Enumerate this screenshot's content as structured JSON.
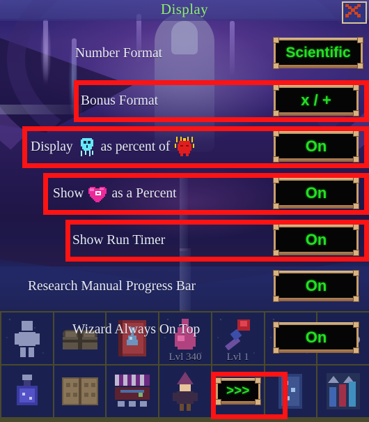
{
  "window": {
    "title": "Display",
    "close_icon": "close-x-icon"
  },
  "colors": {
    "accent_green": "#22e022",
    "title_green": "#8cf06a",
    "highlight_red": "#fd1313",
    "frame_gold": "#c9a06a",
    "label_text": "#e7e9f5"
  },
  "settings": [
    {
      "id": "number-format",
      "label": "Number Format",
      "value": "Scientific",
      "highlighted": false,
      "icons": []
    },
    {
      "id": "bonus-format",
      "label": "Bonus Format",
      "value": "x / +",
      "highlighted": true,
      "icons": []
    },
    {
      "id": "display-as-percent-of",
      "label_before": "Display",
      "label_middle": "as percent of",
      "label_after": "",
      "label": "Display  as percent of",
      "value": "On",
      "highlighted": true,
      "icons": [
        "skull-icon",
        "demon-icon"
      ]
    },
    {
      "id": "show-as-a-percent",
      "label_before": "Show",
      "label_middle": "as a Percent",
      "label": "Show  as a Percent",
      "value": "On",
      "highlighted": true,
      "icons": [
        "heart-icon"
      ]
    },
    {
      "id": "show-run-timer",
      "label": "Show Run Timer",
      "value": "On",
      "highlighted": true,
      "icons": []
    },
    {
      "id": "research-manual-progress-bar",
      "label": "Research Manual Progress Bar",
      "value": "On",
      "highlighted": false,
      "icons": []
    },
    {
      "id": "wizard-always-on-top",
      "label": "Wizard Always On Top",
      "value": "On",
      "highlighted": false,
      "icons": []
    }
  ],
  "grid": {
    "row1": [
      {
        "name": "wizard-figure-icon",
        "level": ""
      },
      {
        "name": "treasure-chest-icon",
        "level": ""
      },
      {
        "name": "red-spellbook-icon",
        "level": ""
      },
      {
        "name": "potion-flask-icon",
        "level": "Lvl 340"
      },
      {
        "name": "red-staff-icon",
        "level": "Lvl 1"
      },
      {
        "name": "blue-gem-icon",
        "level": ""
      },
      {
        "name": "cloud-icon",
        "level": ""
      }
    ],
    "row2": [
      {
        "name": "blue-potion-icon",
        "level": ""
      },
      {
        "name": "open-book-icon",
        "level": ""
      },
      {
        "name": "market-stall-icon",
        "level": ""
      },
      {
        "name": "wizard-character-icon",
        "level": ""
      },
      {
        "name": "next-arrows-button",
        "level": "",
        "value": ">>>",
        "highlighted": true
      },
      {
        "name": "blue-scroll-icon",
        "level": ""
      },
      {
        "name": "stats-bars-icon",
        "level": ""
      }
    ]
  }
}
